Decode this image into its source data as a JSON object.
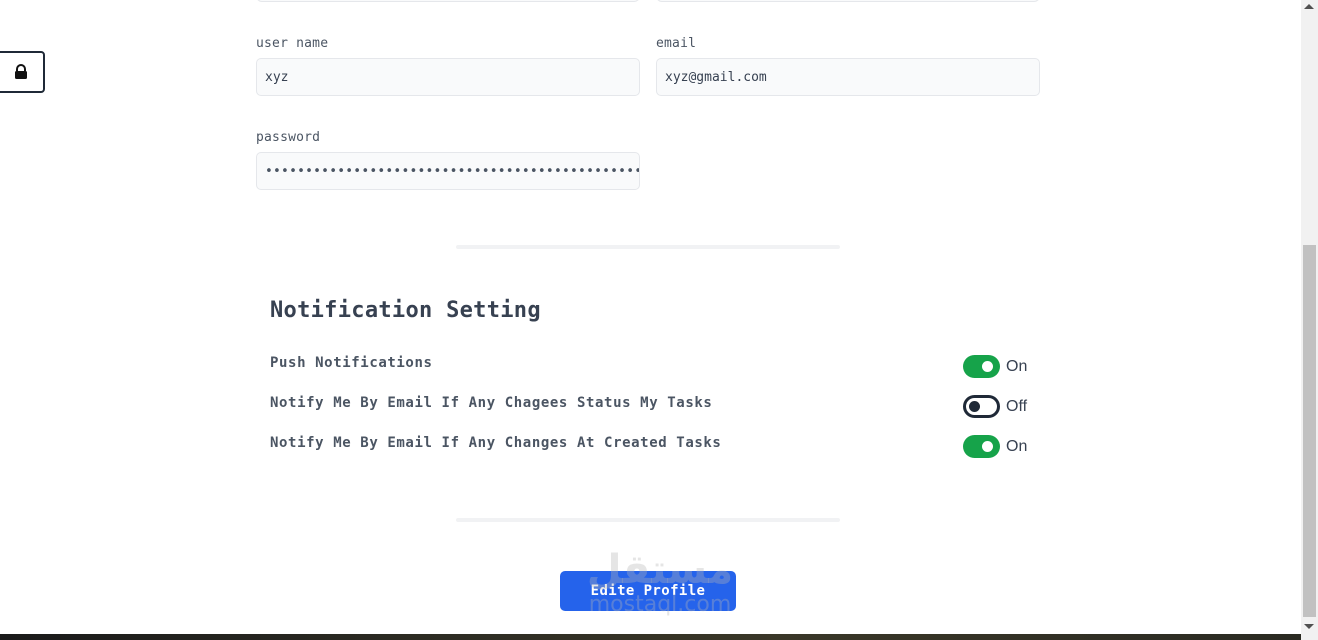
{
  "form": {
    "username": {
      "label": "user name",
      "value": "xyz"
    },
    "email": {
      "label": "email",
      "value": "xyz@gmail.com"
    },
    "password": {
      "label": "password",
      "value": "••••••••••••••••••••••••••••••••••••••••••••••••"
    }
  },
  "notifications": {
    "title": "Notification Setting",
    "items": [
      {
        "label": "Push Notifications",
        "state": "On",
        "enabled": true
      },
      {
        "label": "Notify Me By Email If Any Chagees Status My Tasks",
        "state": "Off",
        "enabled": false
      },
      {
        "label": "Notify Me By Email If Any Changes At Created Tasks",
        "state": "On",
        "enabled": true
      }
    ]
  },
  "actions": {
    "edit_label": "Edite Profile"
  },
  "watermark": {
    "arabic": "مستقل",
    "latin": "mostaql.com"
  },
  "icons": {
    "lock": "lock-icon"
  },
  "colors": {
    "toggle_on": "#16a34a",
    "primary": "#2563eb"
  }
}
